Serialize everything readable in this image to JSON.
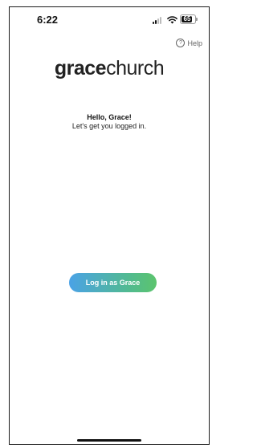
{
  "status_bar": {
    "time": "6:22",
    "battery": "65"
  },
  "help": {
    "label": "Help",
    "icon": "question-circle-icon"
  },
  "logo": {
    "part_bold": "grace",
    "part_light": "church"
  },
  "greeting": {
    "title": "Hello, Grace!",
    "subtitle": "Let's get you logged in."
  },
  "login_button": {
    "label": "Log in as Grace",
    "gradient_start": "#4aa2e6",
    "gradient_end": "#5cc46d"
  }
}
